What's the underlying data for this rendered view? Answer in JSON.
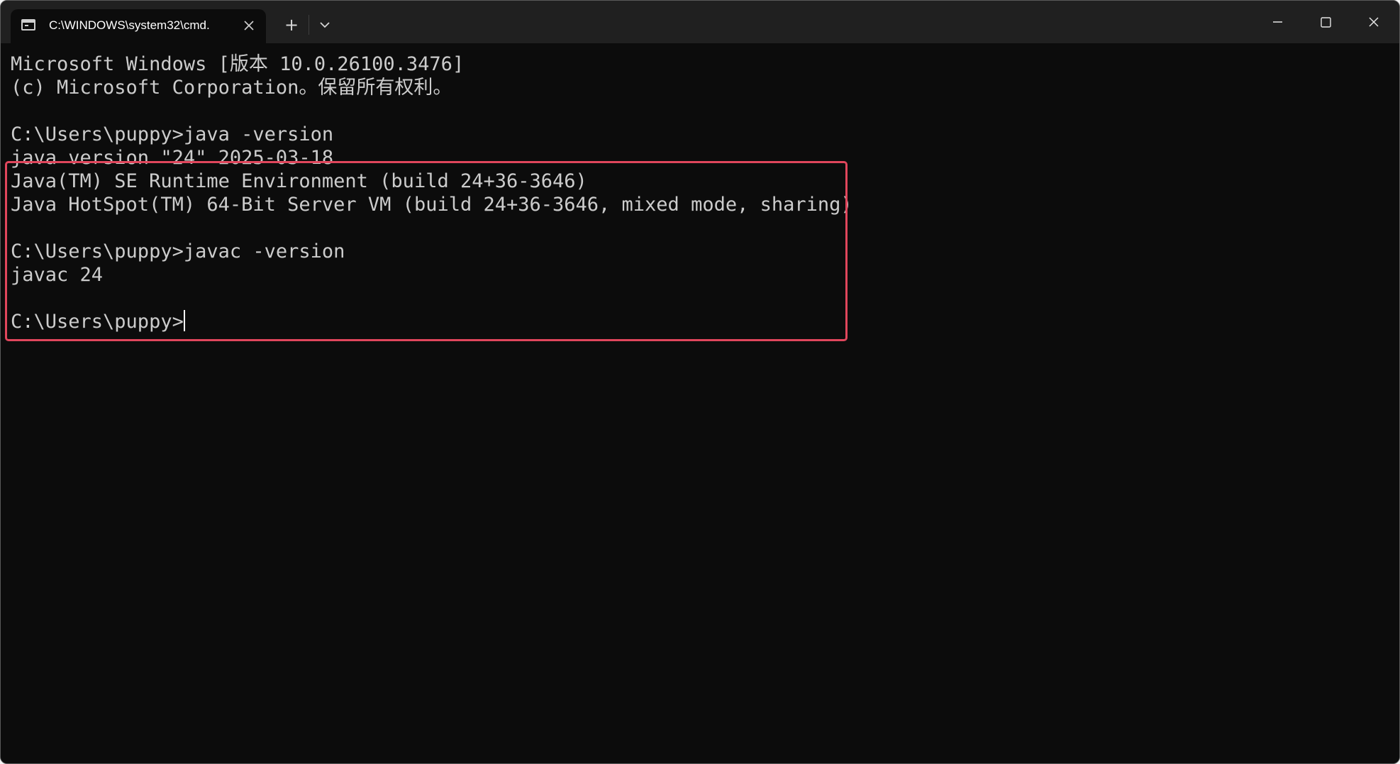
{
  "window": {
    "tab_title": "C:\\WINDOWS\\system32\\cmd.",
    "tab_icon": "terminal-icon",
    "close_tab_icon": "close-icon",
    "new_tab_label": "+",
    "dropdown_icon": "chevron-down-icon",
    "controls": {
      "minimize_icon": "minimize-icon",
      "maximize_icon": "maximize-icon",
      "close_icon": "close-icon"
    }
  },
  "terminal": {
    "lines": [
      "Microsoft Windows [版本 10.0.26100.3476]",
      "(c) Microsoft Corporation。保留所有权利。",
      "",
      "C:\\Users\\puppy>java -version",
      "java version \"24\" 2025-03-18",
      "Java(TM) SE Runtime Environment (build 24+36-3646)",
      "Java HotSpot(TM) 64-Bit Server VM (build 24+36-3646, mixed mode, sharing)",
      "",
      "C:\\Users\\puppy>javac -version",
      "javac 24",
      "",
      "C:\\Users\\puppy>"
    ]
  },
  "colors": {
    "terminal_background": "#0c0c0c",
    "terminal_text": "#cccccc",
    "titlebar_background": "#202020",
    "highlight_border": "#e0465c"
  }
}
